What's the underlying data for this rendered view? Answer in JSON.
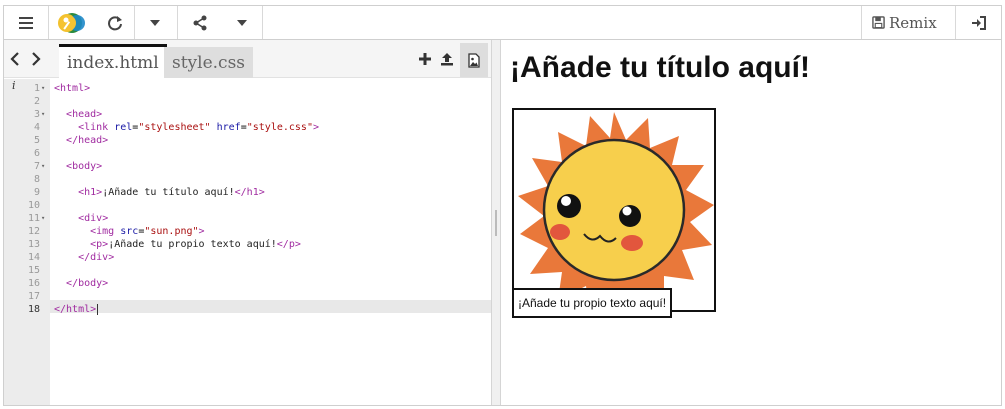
{
  "toolbar": {
    "menu_icon": "hamburger-icon",
    "logo_icon": "key-logo-icon",
    "refresh_icon": "refresh-icon",
    "dropdown_icon": "caret-down-icon",
    "share_icon": "share-icon",
    "remix_label": "Remix",
    "save_icon": "floppy-disk-icon",
    "login_icon": "sign-in-icon"
  },
  "tabs": [
    {
      "label": "index.html"
    },
    {
      "label": "style.css"
    }
  ],
  "code_lines": [
    "<html>",
    "",
    "  <head>",
    "    <link rel=\"stylesheet\" href=\"style.css\">",
    "  </head>",
    "",
    "  <body>",
    "",
    "    <h1>¡Añade tu título aquí!</h1>",
    "",
    "    <div>",
    "      <img src=\"sun.png\">",
    "      <p>¡Añade tu propio texto aquí!</p>",
    "    </div>",
    "",
    "  </body>",
    "",
    "</html>"
  ],
  "line_numbers": [
    "1",
    "2",
    "3",
    "4",
    "5",
    "6",
    "7",
    "8",
    "9",
    "10",
    "11",
    "12",
    "13",
    "14",
    "15",
    "16",
    "17",
    "18"
  ],
  "preview": {
    "heading": "¡Añade tu título aquí!",
    "caption": "¡Añade tu propio texto aquí!"
  },
  "colors": {
    "tag": "#a02ba0",
    "attr": "#1a1aa6",
    "string": "#aa1111",
    "sun_face": "#f7cf4c",
    "sun_rays": "#e9783a",
    "cheek": "#e2563d"
  }
}
